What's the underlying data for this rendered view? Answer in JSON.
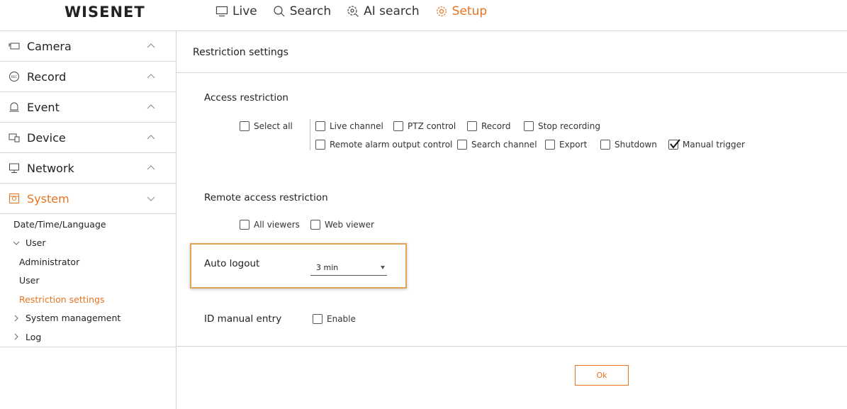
{
  "brand": {
    "logo": "WISENET",
    "accent_color": "#e8731e"
  },
  "topnav": [
    {
      "label": "Live",
      "icon": "monitor-icon",
      "active": false
    },
    {
      "label": "Search",
      "icon": "search-icon",
      "active": false
    },
    {
      "label": "AI search",
      "icon": "ai-search-icon",
      "active": false
    },
    {
      "label": "Setup",
      "icon": "gear-icon",
      "active": true
    }
  ],
  "sidebar": {
    "categories": [
      {
        "label": "Camera",
        "icon": "camera-icon",
        "expanded": false
      },
      {
        "label": "Record",
        "icon": "rec-icon",
        "expanded": false
      },
      {
        "label": "Event",
        "icon": "bell-icon",
        "expanded": false
      },
      {
        "label": "Device",
        "icon": "device-icon",
        "expanded": false
      },
      {
        "label": "Network",
        "icon": "network-icon",
        "expanded": false
      },
      {
        "label": "System",
        "icon": "system-icon",
        "expanded": true
      }
    ],
    "system_items": [
      {
        "label": "Date/Time/Language"
      },
      {
        "label": "User"
      },
      {
        "label": "Administrator"
      },
      {
        "label": "User"
      },
      {
        "label": "Restriction settings"
      },
      {
        "label": "System management"
      },
      {
        "label": "Log"
      }
    ]
  },
  "main": {
    "title": "Restriction settings",
    "access": {
      "label": "Access restriction",
      "select_all": {
        "label": "Select all",
        "checked": false
      },
      "row1": [
        {
          "label": "Live channel",
          "checked": false
        },
        {
          "label": "PTZ control",
          "checked": false
        },
        {
          "label": "Record",
          "checked": false
        },
        {
          "label": "Stop recording",
          "checked": false
        }
      ],
      "row2": [
        {
          "label": "Remote alarm output control",
          "checked": false
        },
        {
          "label": "Search channel",
          "checked": false
        },
        {
          "label": "Export",
          "checked": false
        },
        {
          "label": "Shutdown",
          "checked": false
        },
        {
          "label": "Manual trigger",
          "checked": true
        }
      ]
    },
    "remote": {
      "label": "Remote access restriction",
      "options": [
        {
          "label": "All viewers",
          "checked": false
        },
        {
          "label": "Web viewer",
          "checked": false
        }
      ]
    },
    "auto_logout": {
      "label": "Auto logout",
      "value": "3 min"
    },
    "id_manual": {
      "label": "ID manual entry",
      "enable_label": "Enable",
      "checked": false
    },
    "ok_label": "Ok"
  }
}
